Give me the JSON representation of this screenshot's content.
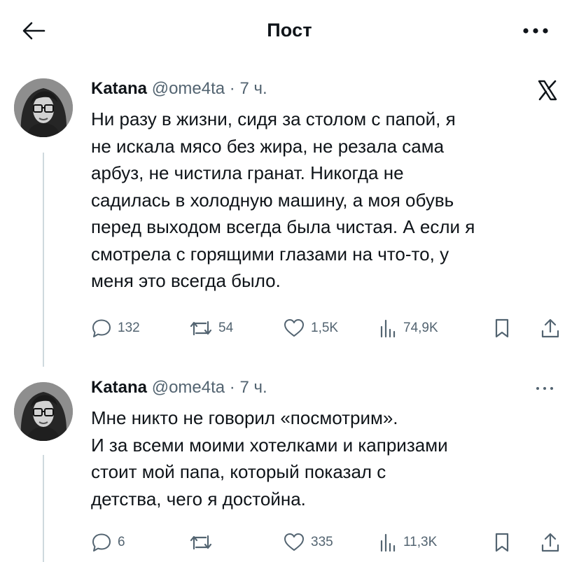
{
  "header": {
    "back_icon": "arrow-left-icon",
    "title": "Пост",
    "more_icon": "more-horizontal-icon"
  },
  "tweets": [
    {
      "author_name": "Katana",
      "handle": "@ome4ta",
      "separator": "·",
      "time": "7 ч.",
      "badge_icon": "x-logo-icon",
      "text_lines": [
        "Ни разу в жизни, сидя за столом с папой, я",
        "не искала мясо без жира, не резала сама",
        "арбуз, не чистила гранат. Никогда не",
        "садилась в холодную машину, а моя обувь",
        "перед выходом всегда была чистая. А если я",
        "смотрела с горящими глазами на что-то, у",
        "меня это всегда было."
      ],
      "replies": "132",
      "reposts": "54",
      "likes": "1,5K",
      "views": "74,9K"
    },
    {
      "author_name": "Katana",
      "handle": "@ome4ta",
      "separator": "·",
      "time": "7 ч.",
      "badge_icon": "more-horizontal-icon",
      "text_lines": [
        "Мне никто не говорил «посмотрим».",
        "И за всеми моими хотелками и капризами",
        "стоит мой папа, который показал с",
        "детства, чего я достойна."
      ],
      "replies": "6",
      "reposts": "",
      "likes": "335",
      "views": "11,3K"
    }
  ],
  "colors": {
    "text_primary": "#0f1419",
    "text_secondary": "#536471",
    "thread_line": "#cfd9de",
    "background": "#ffffff"
  }
}
